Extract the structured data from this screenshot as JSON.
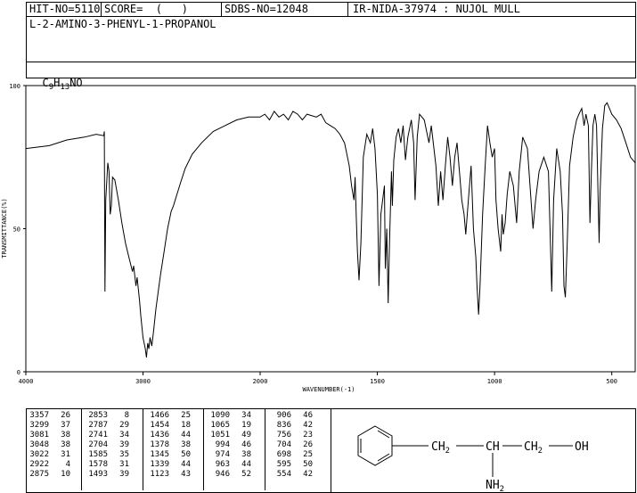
{
  "header": {
    "hit_no": "HIT-NO=5110",
    "score": "SCORE=  (   )",
    "sdbs_no": "SDBS-NO=12048",
    "ir_nida": "IR-NIDA-37974 : NUJOL MULL",
    "compound_name": "L-2-AMINO-3-PHENYL-1-PROPANOL",
    "formula_c": "C",
    "formula_c_sub": "9",
    "formula_h": "H",
    "formula_h_sub": "13",
    "formula_rest": "NO"
  },
  "chart_data": {
    "type": "line",
    "xlabel": "WAVENUMBER(-1)",
    "ylabel": "TRANSMITTANCE(%)",
    "xlim": [
      4000,
      400
    ],
    "ylim": [
      0,
      100
    ],
    "x_ticks": [
      "4000",
      "3000",
      "2000",
      "1500",
      "1000",
      "500"
    ],
    "y_ticks": [
      "100",
      "50",
      "0"
    ],
    "series": [
      {
        "points": [
          [
            4000,
            78
          ],
          [
            3800,
            79
          ],
          [
            3650,
            81
          ],
          [
            3500,
            82
          ],
          [
            3400,
            83
          ],
          [
            3335,
            82.5
          ],
          [
            3330,
            84
          ],
          [
            3325,
            28
          ],
          [
            3318,
            60
          ],
          [
            3300,
            73
          ],
          [
            3290,
            70
          ],
          [
            3280,
            55
          ],
          [
            3270,
            58
          ],
          [
            3260,
            68
          ],
          [
            3240,
            67
          ],
          [
            3210,
            60
          ],
          [
            3180,
            52
          ],
          [
            3150,
            45
          ],
          [
            3120,
            40
          ],
          [
            3090,
            35
          ],
          [
            3080,
            37
          ],
          [
            3060,
            30
          ],
          [
            3050,
            33
          ],
          [
            3030,
            25
          ],
          [
            3020,
            20
          ],
          [
            3000,
            12
          ],
          [
            2980,
            8
          ],
          [
            2970,
            5
          ],
          [
            2960,
            10
          ],
          [
            2950,
            8
          ],
          [
            2940,
            12
          ],
          [
            2925,
            9
          ],
          [
            2910,
            14
          ],
          [
            2890,
            22
          ],
          [
            2870,
            28
          ],
          [
            2850,
            34
          ],
          [
            2820,
            42
          ],
          [
            2790,
            50
          ],
          [
            2760,
            56
          ],
          [
            2740,
            58
          ],
          [
            2710,
            62
          ],
          [
            2680,
            66
          ],
          [
            2640,
            71
          ],
          [
            2580,
            76
          ],
          [
            2500,
            80
          ],
          [
            2400,
            84
          ],
          [
            2300,
            86
          ],
          [
            2200,
            88
          ],
          [
            2100,
            89
          ],
          [
            2000,
            89
          ],
          [
            1980,
            90
          ],
          [
            1960,
            88
          ],
          [
            1940,
            91
          ],
          [
            1920,
            89
          ],
          [
            1900,
            90
          ],
          [
            1880,
            88
          ],
          [
            1860,
            91
          ],
          [
            1840,
            90
          ],
          [
            1820,
            88
          ],
          [
            1800,
            90
          ],
          [
            1760,
            89
          ],
          [
            1740,
            90
          ],
          [
            1720,
            87
          ],
          [
            1700,
            86
          ],
          [
            1680,
            85
          ],
          [
            1660,
            83
          ],
          [
            1640,
            80
          ],
          [
            1620,
            72
          ],
          [
            1610,
            65
          ],
          [
            1600,
            60
          ],
          [
            1595,
            68
          ],
          [
            1590,
            54
          ],
          [
            1585,
            42
          ],
          [
            1578,
            32
          ],
          [
            1570,
            45
          ],
          [
            1560,
            75
          ],
          [
            1545,
            83
          ],
          [
            1530,
            80
          ],
          [
            1520,
            85
          ],
          [
            1510,
            78
          ],
          [
            1500,
            62
          ],
          [
            1493,
            30
          ],
          [
            1485,
            55
          ],
          [
            1470,
            65
          ],
          [
            1466,
            36
          ],
          [
            1460,
            50
          ],
          [
            1454,
            24
          ],
          [
            1448,
            45
          ],
          [
            1440,
            70
          ],
          [
            1436,
            58
          ],
          [
            1430,
            74
          ],
          [
            1420,
            82
          ],
          [
            1410,
            85
          ],
          [
            1400,
            80
          ],
          [
            1390,
            86
          ],
          [
            1380,
            74
          ],
          [
            1370,
            82
          ],
          [
            1355,
            88
          ],
          [
            1345,
            80
          ],
          [
            1339,
            60
          ],
          [
            1330,
            82
          ],
          [
            1320,
            90
          ],
          [
            1300,
            88
          ],
          [
            1280,
            80
          ],
          [
            1270,
            86
          ],
          [
            1250,
            72
          ],
          [
            1240,
            58
          ],
          [
            1230,
            70
          ],
          [
            1220,
            60
          ],
          [
            1210,
            72
          ],
          [
            1200,
            82
          ],
          [
            1190,
            75
          ],
          [
            1180,
            65
          ],
          [
            1170,
            75
          ],
          [
            1160,
            80
          ],
          [
            1150,
            70
          ],
          [
            1140,
            60
          ],
          [
            1130,
            55
          ],
          [
            1123,
            48
          ],
          [
            1110,
            62
          ],
          [
            1100,
            72
          ],
          [
            1090,
            50
          ],
          [
            1080,
            40
          ],
          [
            1075,
            30
          ],
          [
            1068,
            20
          ],
          [
            1062,
            30
          ],
          [
            1051,
            55
          ],
          [
            1040,
            72
          ],
          [
            1030,
            86
          ],
          [
            1020,
            80
          ],
          [
            1010,
            75
          ],
          [
            1000,
            78
          ],
          [
            994,
            60
          ],
          [
            985,
            50
          ],
          [
            974,
            42
          ],
          [
            968,
            55
          ],
          [
            963,
            48
          ],
          [
            955,
            52
          ],
          [
            946,
            62
          ],
          [
            935,
            70
          ],
          [
            920,
            65
          ],
          [
            906,
            52
          ],
          [
            895,
            70
          ],
          [
            880,
            82
          ],
          [
            860,
            78
          ],
          [
            836,
            50
          ],
          [
            825,
            60
          ],
          [
            810,
            70
          ],
          [
            790,
            75
          ],
          [
            770,
            70
          ],
          [
            756,
            28
          ],
          [
            748,
            60
          ],
          [
            735,
            78
          ],
          [
            720,
            70
          ],
          [
            710,
            55
          ],
          [
            704,
            30
          ],
          [
            698,
            26
          ],
          [
            690,
            45
          ],
          [
            680,
            72
          ],
          [
            665,
            82
          ],
          [
            650,
            88
          ],
          [
            640,
            90
          ],
          [
            628,
            92
          ],
          [
            618,
            86
          ],
          [
            610,
            90
          ],
          [
            600,
            86
          ],
          [
            593,
            52
          ],
          [
            587,
            70
          ],
          [
            580,
            86
          ],
          [
            572,
            90
          ],
          [
            565,
            86
          ],
          [
            558,
            60
          ],
          [
            554,
            45
          ],
          [
            550,
            62
          ],
          [
            540,
            85
          ],
          [
            530,
            93
          ],
          [
            520,
            94
          ],
          [
            510,
            92
          ],
          [
            500,
            90
          ],
          [
            480,
            88
          ],
          [
            460,
            85
          ],
          [
            440,
            80
          ],
          [
            420,
            75
          ],
          [
            400,
            73
          ]
        ]
      }
    ]
  },
  "peak_table": {
    "columns": [
      [
        [
          "3357",
          "26"
        ],
        [
          "3299",
          "37"
        ],
        [
          "3081",
          "38"
        ],
        [
          "3048",
          "38"
        ],
        [
          "3022",
          "31"
        ],
        [
          "2922",
          "4"
        ],
        [
          "2875",
          "10"
        ]
      ],
      [
        [
          "2853",
          "8"
        ],
        [
          "2787",
          "29"
        ],
        [
          "2741",
          "34"
        ],
        [
          "2704",
          "39"
        ],
        [
          "1585",
          "35"
        ],
        [
          "1578",
          "31"
        ],
        [
          "1493",
          "39"
        ]
      ],
      [
        [
          "1466",
          "25"
        ],
        [
          "1454",
          "18"
        ],
        [
          "1436",
          "44"
        ],
        [
          "1378",
          "38"
        ],
        [
          "1345",
          "50"
        ],
        [
          "1339",
          "44"
        ],
        [
          "1123",
          "43"
        ]
      ],
      [
        [
          "1090",
          "34"
        ],
        [
          "1065",
          "19"
        ],
        [
          "1051",
          "49"
        ],
        [
          "994",
          "46"
        ],
        [
          "974",
          "38"
        ],
        [
          "963",
          "44"
        ],
        [
          "946",
          "52"
        ]
      ],
      [
        [
          "906",
          "46"
        ],
        [
          "836",
          "42"
        ],
        [
          "756",
          "23"
        ],
        [
          "704",
          "26"
        ],
        [
          "698",
          "25"
        ],
        [
          "595",
          "50"
        ],
        [
          "554",
          "42"
        ]
      ]
    ]
  },
  "structure": {
    "ch2_left": "CH",
    "ch2_left_sub": "2",
    "ch": "CH",
    "ch2_right": "CH",
    "ch2_right_sub": "2",
    "oh": "OH",
    "nh2": "NH",
    "nh2_sub": "2"
  }
}
